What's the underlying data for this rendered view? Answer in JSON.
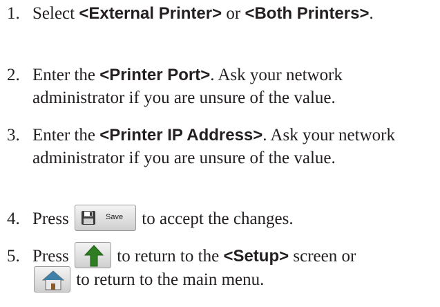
{
  "steps": [
    {
      "num": "1.",
      "a": "Select ",
      "b1": "<External Printer>",
      "c": " or ",
      "b2": "<Both Printers>",
      "d": "."
    },
    {
      "num": "2.",
      "a": "Enter the ",
      "b1": "<Printer Port>",
      "c": ". Ask your network administrator if you are unsure of the value."
    },
    {
      "num": "3.",
      "a": "Enter the ",
      "b1": "<Printer IP Address>",
      "c": ". Ask your network administrator if you are unsure of the value."
    },
    {
      "num": "4.",
      "a": "Press ",
      "button_label": "Save",
      "c": " to accept the changes."
    },
    {
      "num": "5.",
      "a": "Press ",
      "c": " to return to the ",
      "b1": "<Setup>",
      "d": " screen or",
      "e": " to return to the main menu."
    }
  ],
  "icons": {
    "save": "floppy-disk-icon",
    "up": "up-arrow-icon",
    "home": "home-icon"
  }
}
